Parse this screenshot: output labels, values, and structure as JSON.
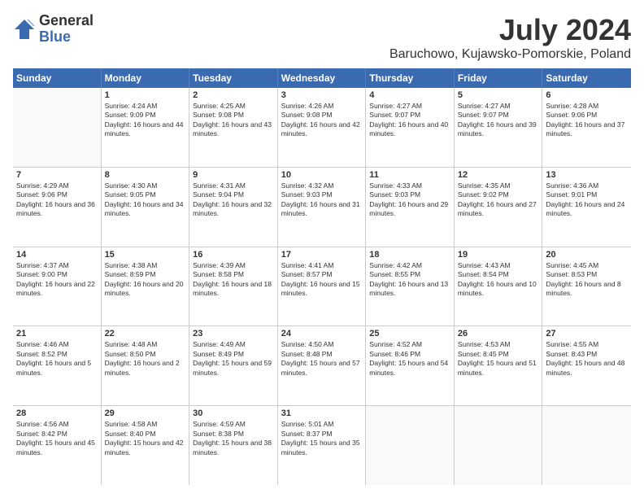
{
  "logo": {
    "general": "General",
    "blue": "Blue"
  },
  "title": "July 2024",
  "subtitle": "Baruchowo, Kujawsko-Pomorskie, Poland",
  "header_days": [
    "Sunday",
    "Monday",
    "Tuesday",
    "Wednesday",
    "Thursday",
    "Friday",
    "Saturday"
  ],
  "weeks": [
    [
      {
        "day": "",
        "sunrise": "",
        "sunset": "",
        "daylight": ""
      },
      {
        "day": "1",
        "sunrise": "Sunrise: 4:24 AM",
        "sunset": "Sunset: 9:09 PM",
        "daylight": "Daylight: 16 hours and 44 minutes."
      },
      {
        "day": "2",
        "sunrise": "Sunrise: 4:25 AM",
        "sunset": "Sunset: 9:08 PM",
        "daylight": "Daylight: 16 hours and 43 minutes."
      },
      {
        "day": "3",
        "sunrise": "Sunrise: 4:26 AM",
        "sunset": "Sunset: 9:08 PM",
        "daylight": "Daylight: 16 hours and 42 minutes."
      },
      {
        "day": "4",
        "sunrise": "Sunrise: 4:27 AM",
        "sunset": "Sunset: 9:07 PM",
        "daylight": "Daylight: 16 hours and 40 minutes."
      },
      {
        "day": "5",
        "sunrise": "Sunrise: 4:27 AM",
        "sunset": "Sunset: 9:07 PM",
        "daylight": "Daylight: 16 hours and 39 minutes."
      },
      {
        "day": "6",
        "sunrise": "Sunrise: 4:28 AM",
        "sunset": "Sunset: 9:06 PM",
        "daylight": "Daylight: 16 hours and 37 minutes."
      }
    ],
    [
      {
        "day": "7",
        "sunrise": "Sunrise: 4:29 AM",
        "sunset": "Sunset: 9:06 PM",
        "daylight": "Daylight: 16 hours and 36 minutes."
      },
      {
        "day": "8",
        "sunrise": "Sunrise: 4:30 AM",
        "sunset": "Sunset: 9:05 PM",
        "daylight": "Daylight: 16 hours and 34 minutes."
      },
      {
        "day": "9",
        "sunrise": "Sunrise: 4:31 AM",
        "sunset": "Sunset: 9:04 PM",
        "daylight": "Daylight: 16 hours and 32 minutes."
      },
      {
        "day": "10",
        "sunrise": "Sunrise: 4:32 AM",
        "sunset": "Sunset: 9:03 PM",
        "daylight": "Daylight: 16 hours and 31 minutes."
      },
      {
        "day": "11",
        "sunrise": "Sunrise: 4:33 AM",
        "sunset": "Sunset: 9:03 PM",
        "daylight": "Daylight: 16 hours and 29 minutes."
      },
      {
        "day": "12",
        "sunrise": "Sunrise: 4:35 AM",
        "sunset": "Sunset: 9:02 PM",
        "daylight": "Daylight: 16 hours and 27 minutes."
      },
      {
        "day": "13",
        "sunrise": "Sunrise: 4:36 AM",
        "sunset": "Sunset: 9:01 PM",
        "daylight": "Daylight: 16 hours and 24 minutes."
      }
    ],
    [
      {
        "day": "14",
        "sunrise": "Sunrise: 4:37 AM",
        "sunset": "Sunset: 9:00 PM",
        "daylight": "Daylight: 16 hours and 22 minutes."
      },
      {
        "day": "15",
        "sunrise": "Sunrise: 4:38 AM",
        "sunset": "Sunset: 8:59 PM",
        "daylight": "Daylight: 16 hours and 20 minutes."
      },
      {
        "day": "16",
        "sunrise": "Sunrise: 4:39 AM",
        "sunset": "Sunset: 8:58 PM",
        "daylight": "Daylight: 16 hours and 18 minutes."
      },
      {
        "day": "17",
        "sunrise": "Sunrise: 4:41 AM",
        "sunset": "Sunset: 8:57 PM",
        "daylight": "Daylight: 16 hours and 15 minutes."
      },
      {
        "day": "18",
        "sunrise": "Sunrise: 4:42 AM",
        "sunset": "Sunset: 8:55 PM",
        "daylight": "Daylight: 16 hours and 13 minutes."
      },
      {
        "day": "19",
        "sunrise": "Sunrise: 4:43 AM",
        "sunset": "Sunset: 8:54 PM",
        "daylight": "Daylight: 16 hours and 10 minutes."
      },
      {
        "day": "20",
        "sunrise": "Sunrise: 4:45 AM",
        "sunset": "Sunset: 8:53 PM",
        "daylight": "Daylight: 16 hours and 8 minutes."
      }
    ],
    [
      {
        "day": "21",
        "sunrise": "Sunrise: 4:46 AM",
        "sunset": "Sunset: 8:52 PM",
        "daylight": "Daylight: 16 hours and 5 minutes."
      },
      {
        "day": "22",
        "sunrise": "Sunrise: 4:48 AM",
        "sunset": "Sunset: 8:50 PM",
        "daylight": "Daylight: 16 hours and 2 minutes."
      },
      {
        "day": "23",
        "sunrise": "Sunrise: 4:49 AM",
        "sunset": "Sunset: 8:49 PM",
        "daylight": "Daylight: 15 hours and 59 minutes."
      },
      {
        "day": "24",
        "sunrise": "Sunrise: 4:50 AM",
        "sunset": "Sunset: 8:48 PM",
        "daylight": "Daylight: 15 hours and 57 minutes."
      },
      {
        "day": "25",
        "sunrise": "Sunrise: 4:52 AM",
        "sunset": "Sunset: 8:46 PM",
        "daylight": "Daylight: 15 hours and 54 minutes."
      },
      {
        "day": "26",
        "sunrise": "Sunrise: 4:53 AM",
        "sunset": "Sunset: 8:45 PM",
        "daylight": "Daylight: 15 hours and 51 minutes."
      },
      {
        "day": "27",
        "sunrise": "Sunrise: 4:55 AM",
        "sunset": "Sunset: 8:43 PM",
        "daylight": "Daylight: 15 hours and 48 minutes."
      }
    ],
    [
      {
        "day": "28",
        "sunrise": "Sunrise: 4:56 AM",
        "sunset": "Sunset: 8:42 PM",
        "daylight": "Daylight: 15 hours and 45 minutes."
      },
      {
        "day": "29",
        "sunrise": "Sunrise: 4:58 AM",
        "sunset": "Sunset: 8:40 PM",
        "daylight": "Daylight: 15 hours and 42 minutes."
      },
      {
        "day": "30",
        "sunrise": "Sunrise: 4:59 AM",
        "sunset": "Sunset: 8:38 PM",
        "daylight": "Daylight: 15 hours and 38 minutes."
      },
      {
        "day": "31",
        "sunrise": "Sunrise: 5:01 AM",
        "sunset": "Sunset: 8:37 PM",
        "daylight": "Daylight: 15 hours and 35 minutes."
      },
      {
        "day": "",
        "sunrise": "",
        "sunset": "",
        "daylight": ""
      },
      {
        "day": "",
        "sunrise": "",
        "sunset": "",
        "daylight": ""
      },
      {
        "day": "",
        "sunrise": "",
        "sunset": "",
        "daylight": ""
      }
    ]
  ]
}
